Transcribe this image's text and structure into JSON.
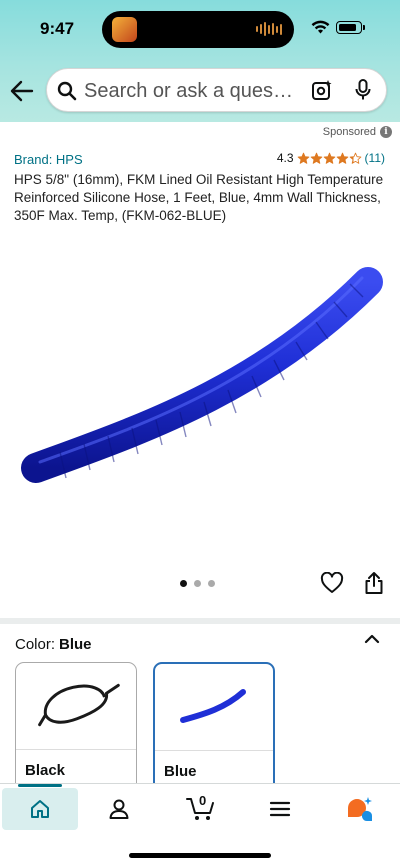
{
  "status_bar": {
    "time": "9:47"
  },
  "search": {
    "placeholder": "Search or ask a question"
  },
  "sponsored": {
    "label": "Sponsored",
    "info_glyph": "i"
  },
  "product": {
    "brand": "Brand: HPS",
    "rating_value": "4.3",
    "rating_count": "(11)",
    "stars": 4.3,
    "title": "HPS 5/8\" (16mm), FKM Lined Oil Resistant High Temperature Reinforced Silicone Hose, 1 Feet, Blue, 4mm Wall Thickness, 350F Max. Temp, (FKM-062-BLUE)",
    "image_icon": "blue-silicone-hose",
    "carousel": {
      "total": 3,
      "active": 1
    }
  },
  "color_selector": {
    "label": "Color:",
    "selected": "Blue",
    "options": [
      {
        "name": "Black",
        "swatch_color": "#1a1a1a"
      },
      {
        "name": "Blue",
        "swatch_color": "#1f2fd6"
      }
    ]
  },
  "bottom_nav": {
    "items": [
      {
        "name": "home",
        "icon": "home-icon"
      },
      {
        "name": "you",
        "icon": "person-icon"
      },
      {
        "name": "cart",
        "icon": "cart-icon"
      },
      {
        "name": "menu",
        "icon": "hamburger-icon"
      },
      {
        "name": "rufus",
        "icon": "rufus-icon"
      }
    ],
    "cart_count": "0"
  },
  "colors": {
    "header_gradient_top": "#86dcdc",
    "header_gradient_bottom": "#b8e9e2",
    "link": "#007185",
    "star": "#de7921",
    "hose_blue": "#1f2fd6",
    "selected_border": "#2a6fb7"
  }
}
